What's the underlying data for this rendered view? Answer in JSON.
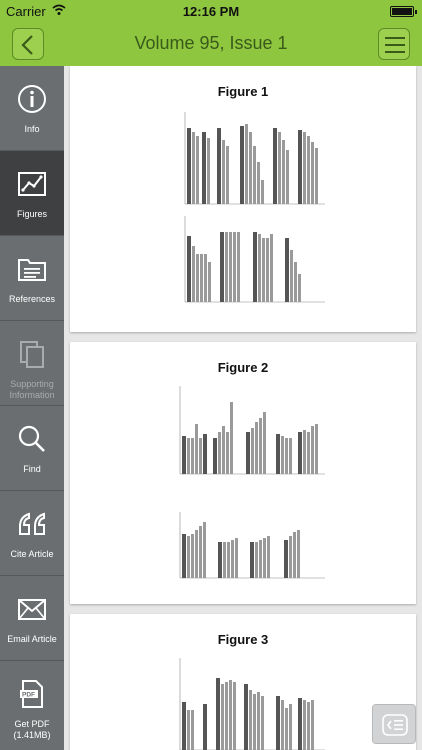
{
  "status_bar": {
    "carrier": "Carrier",
    "time": "12:16 PM"
  },
  "nav": {
    "title": "Volume 95, Issue 1",
    "back_icon": "chevron-left-icon",
    "menu_icon": "hamburger-menu-icon"
  },
  "sidebar": {
    "items": [
      {
        "label": "Info",
        "icon": "info-icon",
        "active": false,
        "disabled": false
      },
      {
        "label": "Figures",
        "icon": "chart-icon",
        "active": true,
        "disabled": false
      },
      {
        "label": "References",
        "icon": "folder-list-icon",
        "active": false,
        "disabled": false
      },
      {
        "label": "Supporting Information",
        "icon": "copy-documents-icon",
        "active": false,
        "disabled": true
      },
      {
        "label": "Find",
        "icon": "search-icon",
        "active": false,
        "disabled": false
      },
      {
        "label": "Cite Article",
        "icon": "quote-icon",
        "active": false,
        "disabled": false
      },
      {
        "label": "Email Article",
        "icon": "envelope-icon",
        "active": false,
        "disabled": false
      },
      {
        "label": "Get PDF (1.41MB)",
        "icon": "pdf-icon",
        "active": false,
        "disabled": false
      }
    ]
  },
  "figures": [
    {
      "title": "Figure 1"
    },
    {
      "title": "Figure 2"
    },
    {
      "title": "Figure 3"
    }
  ],
  "colors": {
    "accent": "#8ec63f",
    "sidebar": "#6b6e70",
    "sidebar_active": "#3e4042"
  }
}
